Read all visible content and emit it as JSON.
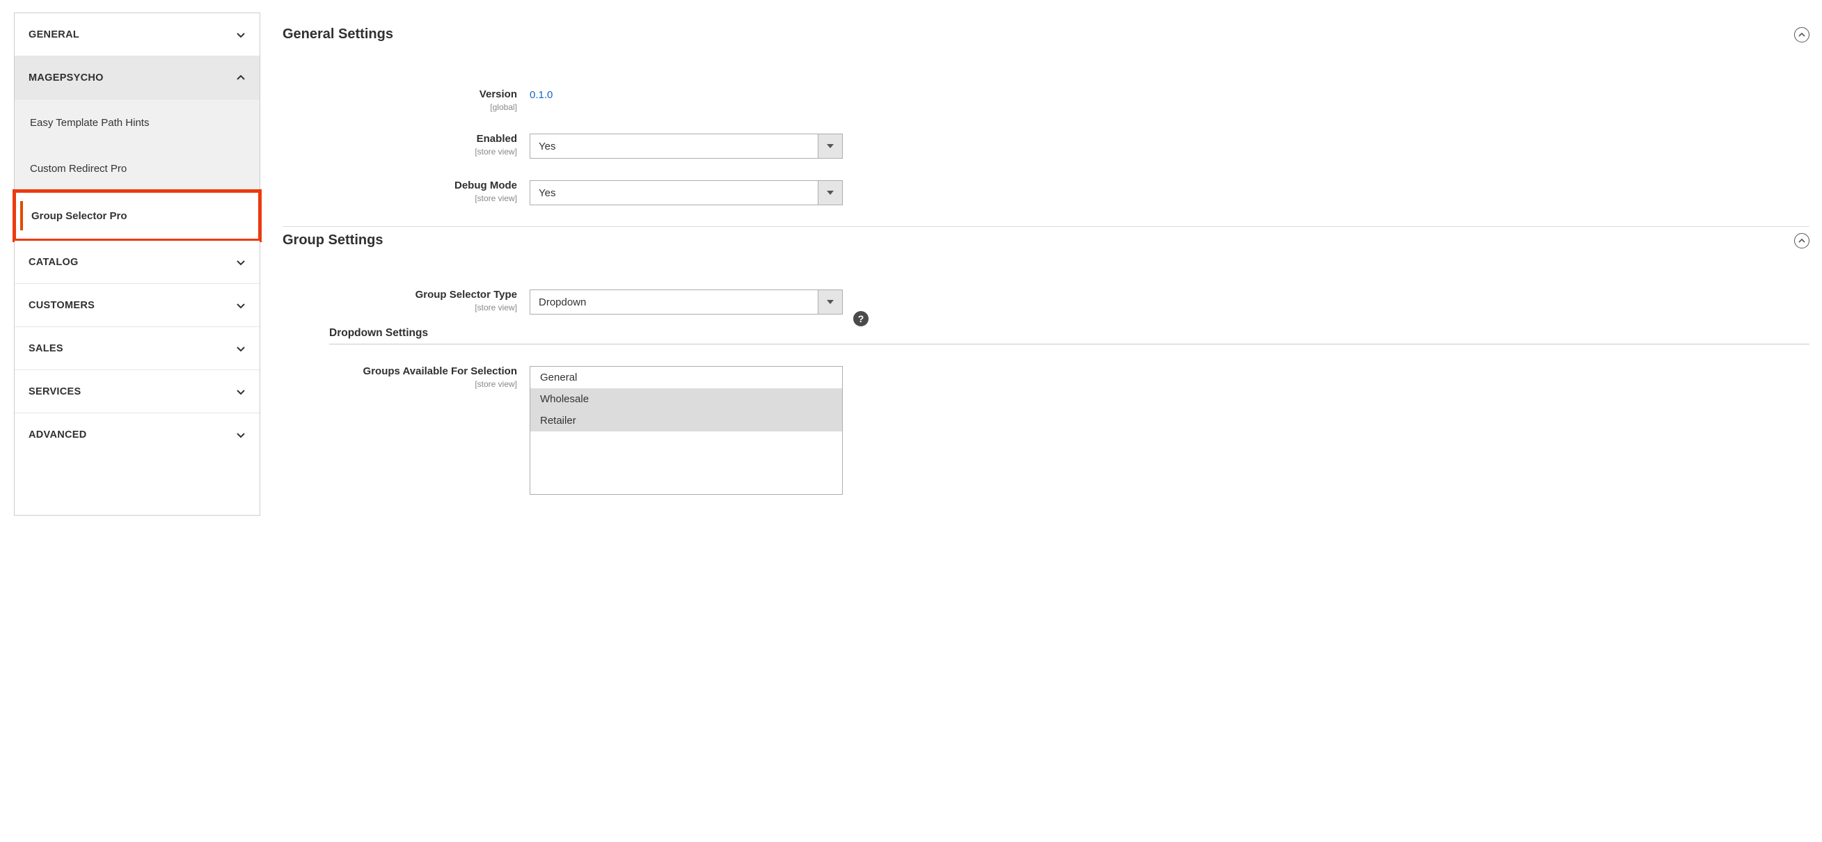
{
  "sidebar": {
    "tabs": [
      {
        "label": "GENERAL",
        "expanded": false
      },
      {
        "label": "MAGEPSYCHO",
        "expanded": true
      },
      {
        "label": "CATALOG",
        "expanded": false
      },
      {
        "label": "CUSTOMERS",
        "expanded": false
      },
      {
        "label": "SALES",
        "expanded": false
      },
      {
        "label": "SERVICES",
        "expanded": false
      },
      {
        "label": "ADVANCED",
        "expanded": false
      }
    ],
    "magepsycho_items": [
      {
        "label": "Easy Template Path Hints",
        "active": false
      },
      {
        "label": "Custom Redirect Pro",
        "active": false
      },
      {
        "label": "Group Selector Pro",
        "active": true
      }
    ]
  },
  "sections": {
    "general": {
      "title": "General Settings",
      "fields": {
        "version": {
          "label": "Version",
          "scope": "[global]",
          "value": "0.1.0"
        },
        "enabled": {
          "label": "Enabled",
          "scope": "[store view]",
          "value": "Yes"
        },
        "debug": {
          "label": "Debug Mode",
          "scope": "[store view]",
          "value": "Yes"
        }
      }
    },
    "group": {
      "title": "Group Settings",
      "fields": {
        "selector_type": {
          "label": "Group Selector Type",
          "scope": "[store view]",
          "value": "Dropdown"
        }
      },
      "subsection_title": "Dropdown Settings",
      "groups_field": {
        "label": "Groups Available For Selection",
        "scope": "[store view]"
      },
      "groups_options": [
        {
          "label": "General",
          "selected": false
        },
        {
          "label": "Wholesale",
          "selected": true
        },
        {
          "label": "Retailer",
          "selected": true
        }
      ]
    }
  },
  "icons": {
    "help": "?"
  }
}
